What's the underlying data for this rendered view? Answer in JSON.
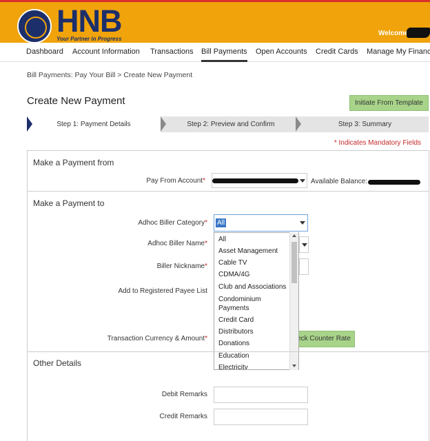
{
  "header": {
    "brand": "HNB",
    "tagline": "Your Partner in Progress",
    "welcome": "Welcome"
  },
  "nav": {
    "items": [
      "Dashboard",
      "Account Information",
      "Transactions",
      "Bill Payments",
      "Open Accounts",
      "Credit Cards",
      "Manage My Financi"
    ],
    "active": "Bill Payments"
  },
  "breadcrumb": "Bill Payments: Pay Your Bill > Create New Payment",
  "page_title": "Create New Payment",
  "template_button": "Initiate From Template",
  "steps": [
    "Step 1: Payment Details",
    "Step 2: Preview and Confirm",
    "Step 3: Summary"
  ],
  "mandatory_note": "* Indicates Mandatory Fields",
  "section_from": {
    "title": "Make a Payment from",
    "pay_from_label": "Pay From Account",
    "available_label": "Available Balance:"
  },
  "section_to": {
    "title": "Make a Payment to",
    "category_label": "Adhoc Biller Category",
    "category_value": "All",
    "name_label": "Adhoc Biller Name",
    "nickname_label": "Biller Nickname",
    "payee_label": "Add to Registered Payee List",
    "currency_label": "Transaction Currency & Amount",
    "counter_rate_button": "eck Counter Rate"
  },
  "dropdown_options": [
    "All",
    "Asset Management",
    "Cable TV",
    "CDMA/4G",
    "Club and Associations",
    "Condominium",
    "Payments",
    "Credit Card",
    "Distributors",
    "Donations",
    "Education",
    "Electricity"
  ],
  "section_other": {
    "title": "Other Details",
    "debit_label": "Debit Remarks",
    "credit_label": "Credit Remarks"
  }
}
